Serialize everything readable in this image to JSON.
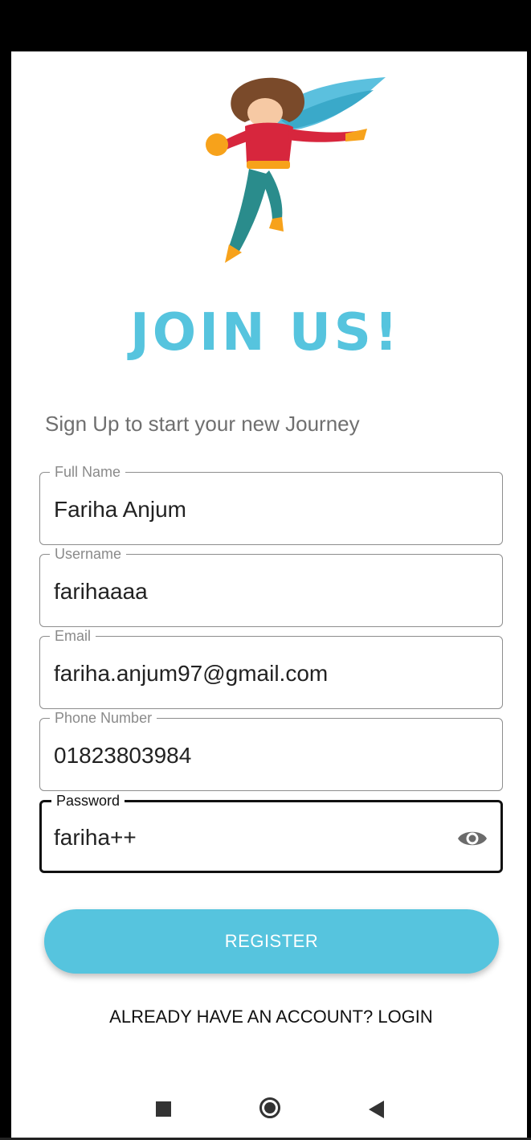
{
  "header": {
    "title": "JOIN US!",
    "subtitle": "Sign Up to start your new Journey"
  },
  "hero": {
    "icon": "superhero-illustration"
  },
  "form": {
    "full_name": {
      "label": "Full Name",
      "value": "Fariha Anjum"
    },
    "username": {
      "label": "Username",
      "value": "farihaaaa"
    },
    "email": {
      "label": "Email",
      "value": "fariha.anjum97@gmail.com"
    },
    "phone": {
      "label": "Phone Number",
      "value": "01823803984"
    },
    "password": {
      "label": "Password",
      "value": "fariha++",
      "toggle_icon": "eye-icon"
    }
  },
  "actions": {
    "register_label": "REGISTER",
    "login_label": "ALREADY HAVE AN ACCOUNT? LOGIN"
  },
  "nav": {
    "recents_icon": "square-icon",
    "home_icon": "circle-icon",
    "back_icon": "back-triangle-icon"
  },
  "colors": {
    "accent": "#56c4de",
    "hero_costume": "#d7263d",
    "hero_cape": "#5bc0de",
    "hero_gold": "#f7a21b"
  }
}
